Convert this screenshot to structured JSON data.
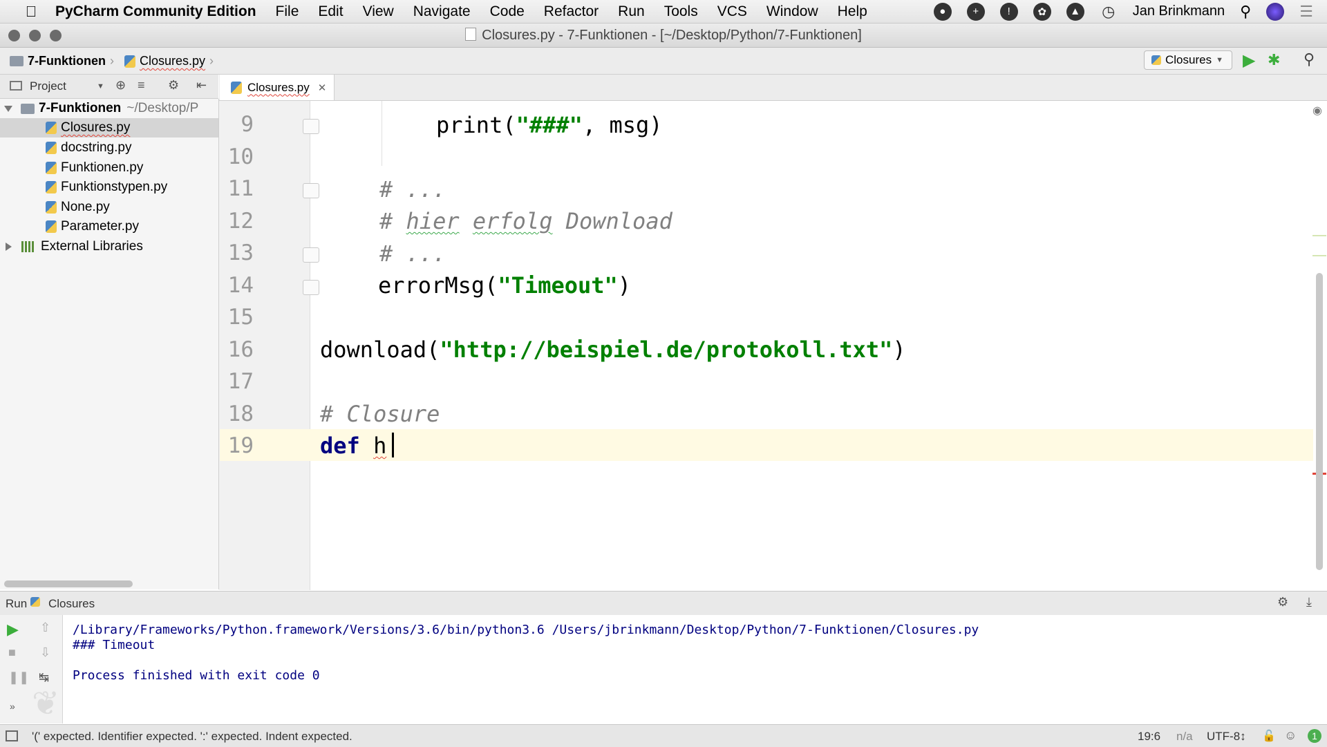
{
  "menubar": {
    "app_name": "PyCharm Community Edition",
    "items": [
      "File",
      "Edit",
      "View",
      "Navigate",
      "Code",
      "Refactor",
      "Run",
      "Tools",
      "VCS",
      "Window",
      "Help"
    ],
    "user": "Jan Brinkmann"
  },
  "window": {
    "title": "Closures.py - 7-Funktionen - [~/Desktop/Python/7-Funktionen]"
  },
  "navbar": {
    "crumb_project": "7-Funktionen",
    "crumb_file": "Closures.py",
    "run_config": "Closures"
  },
  "project_panel": {
    "header": "Project",
    "root_name": "7-Funktionen",
    "root_path": "~/Desktop/P",
    "files": [
      "Closures.py",
      "docstring.py",
      "Funktionen.py",
      "Funktionstypen.py",
      "None.py",
      "Parameter.py"
    ],
    "selected": "Closures.py",
    "external": "External Libraries"
  },
  "editor": {
    "tab": "Closures.py",
    "line_numbers": [
      "9",
      "10",
      "11",
      "12",
      "13",
      "14",
      "15",
      "16",
      "17",
      "18",
      "19"
    ],
    "code": {
      "l9_fn": "print(",
      "l9_str": "\"###\"",
      "l9_rest": ", msg)",
      "l11": "# ...",
      "l12_hash": "# ",
      "l12_w1": "hier",
      "l12_w2": "erfolg",
      "l12_w3": "Download",
      "l13": "# ...",
      "l14_fn": "errorMsg(",
      "l14_str": "\"Timeout\"",
      "l14_close": ")",
      "l16_fn": "download(",
      "l16_str": "\"http://beispiel.de/protokoll.txt\"",
      "l16_close": ")",
      "l18": "# Closure",
      "l19_kw": "def",
      "l19_name": "h"
    }
  },
  "run_panel": {
    "label": "Run",
    "config": "Closures",
    "output": [
      "/Library/Frameworks/Python.framework/Versions/3.6/bin/python3.6 /Users/jbrinkmann/Desktop/Python/7-Funktionen/Closures.py",
      "### Timeout",
      "",
      "Process finished with exit code 0"
    ]
  },
  "statusbar": {
    "message": "'(' expected. Identifier expected. ':' expected. Indent expected.",
    "position": "19:6",
    "na": "n/a",
    "encoding": "UTF-8↕",
    "badge": "1"
  },
  "colors": {
    "keyword": "#000080",
    "string": "#008000",
    "comment": "#808080",
    "error_underline": "#e0453a"
  }
}
